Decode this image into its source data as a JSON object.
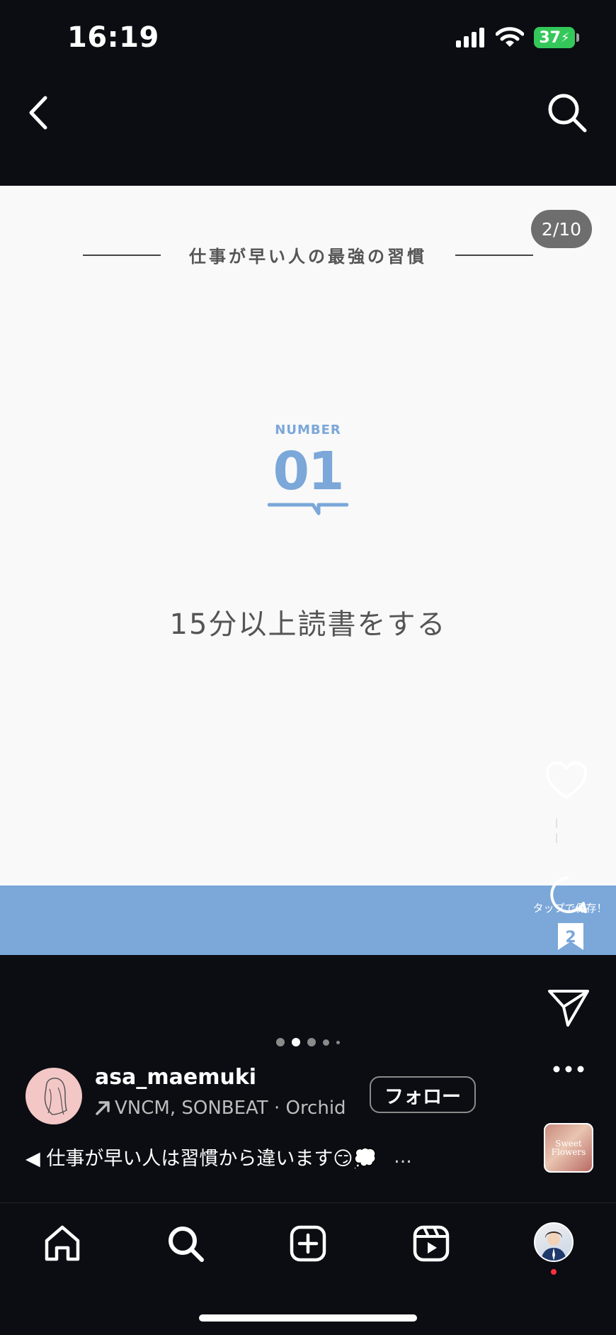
{
  "status_bar": {
    "time": "16:19",
    "battery": "37"
  },
  "post": {
    "counter": "2/10",
    "title": "仕事が早い人の最強の習慣",
    "number_label": "NUMBER",
    "number": "01",
    "main_text": "15分以上読書をする"
  },
  "actions": {
    "likes_text": "l l",
    "tap_to_save": "タップで保存！",
    "saves_count": "2"
  },
  "account": {
    "username": "asa_maemuki",
    "music": "VNCM, SONBEAT · Orchid",
    "follow_label": "フォロー"
  },
  "caption": {
    "text": "◀ 仕事が早い人は習慣から違います😏💭",
    "more": "..."
  },
  "music_thumb": {
    "text": "Sweet Flowers"
  },
  "icons": {
    "back": "chevron-left-icon",
    "search": "search-icon",
    "heart": "heart-icon",
    "comment": "comment-icon",
    "bookmark": "bookmark-icon",
    "send": "send-icon",
    "more": "more-icon",
    "home": "home-icon",
    "explore": "search-icon",
    "create": "plus-square-icon",
    "reels": "reels-icon",
    "profile": "avatar"
  },
  "colors": {
    "accent": "#7ba7d9",
    "background": "#0b0d12",
    "post_bg": "#f9f9f9",
    "battery": "#34c759",
    "notification": "#ff3040"
  },
  "carousel": {
    "total_dots": 5,
    "active_index": 1
  }
}
